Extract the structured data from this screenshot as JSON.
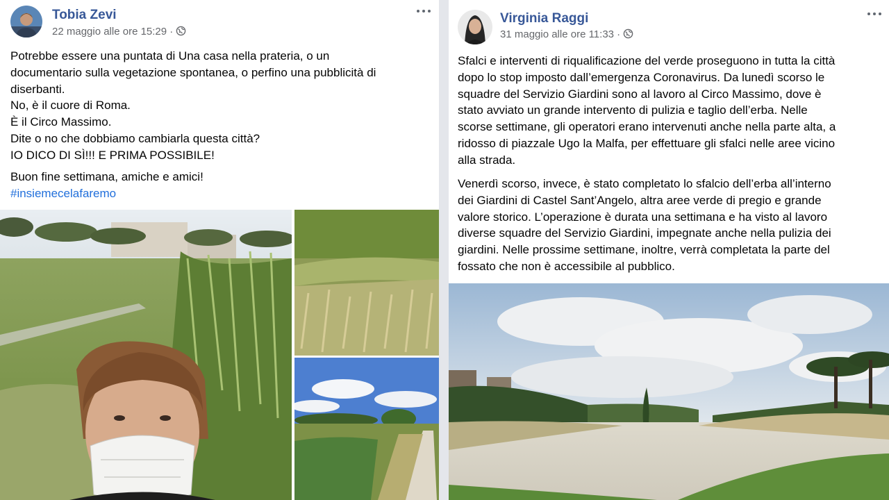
{
  "left_post": {
    "author": "Tobia Zevi",
    "timestamp": "22 maggio alle ore 15:29 ·",
    "privacy_icon": "globe-icon",
    "more_icon": "more-options-icon",
    "paragraphs": [
      [
        "Potrebbe essere una puntata di Una casa nella prateria, o un",
        "documentario sulla vegetazione spontanea, o perfino una pubblicità di",
        "diserbanti.",
        "No, è il cuore di Roma.",
        "È il Circo Massimo.",
        "Dite o no che dobbiamo cambiarla questa città?",
        "IO DICO DI SÌ!!! E PRIMA POSSIBILE!"
      ],
      [
        "Buon fine settimana, amiche e amici!"
      ]
    ],
    "hashtag": "#insiemecelafaremo"
  },
  "right_post": {
    "author": "Virginia Raggi",
    "timestamp": "31 maggio alle ore 11:33 ·",
    "privacy_icon": "globe-icon",
    "more_icon": "more-options-icon",
    "paragraphs": [
      [
        "Sfalci e interventi di riqualificazione del verde proseguono in tutta la città",
        "dopo lo stop imposto dall’emergenza Coronavirus. Da lunedì scorso le",
        "squadre del Servizio Giardini sono al lavoro al Circo Massimo, dove è",
        "stato avviato un grande intervento di pulizia e taglio dell’erba. Nelle",
        "scorse settimane, gli operatori erano intervenuti anche nella parte alta, a",
        "ridosso di piazzale Ugo la Malfa, per effettuare gli sfalci nelle aree vicino",
        "alla strada."
      ],
      [
        "Venerdì scorso, invece, è stato completato lo sfalcio dell’erba all’interno",
        "dei Giardini di Castel Sant’Angelo, altra aree verde di pregio e grande",
        "valore storico. L’operazione è durata una settimana e ha visto al lavoro",
        "diverse squadre del Servizio Giardini, impegnate anche nella pulizia dei",
        "giardini. Nelle prossime settimane, inoltre, verrà completata la parte del",
        "fossato che non è accessibile al pubblico."
      ]
    ]
  },
  "colors": {
    "author_link": "#385898",
    "hashtag": "#216fdb",
    "meta_text": "#65676b",
    "divider": "#e4e6eb"
  }
}
